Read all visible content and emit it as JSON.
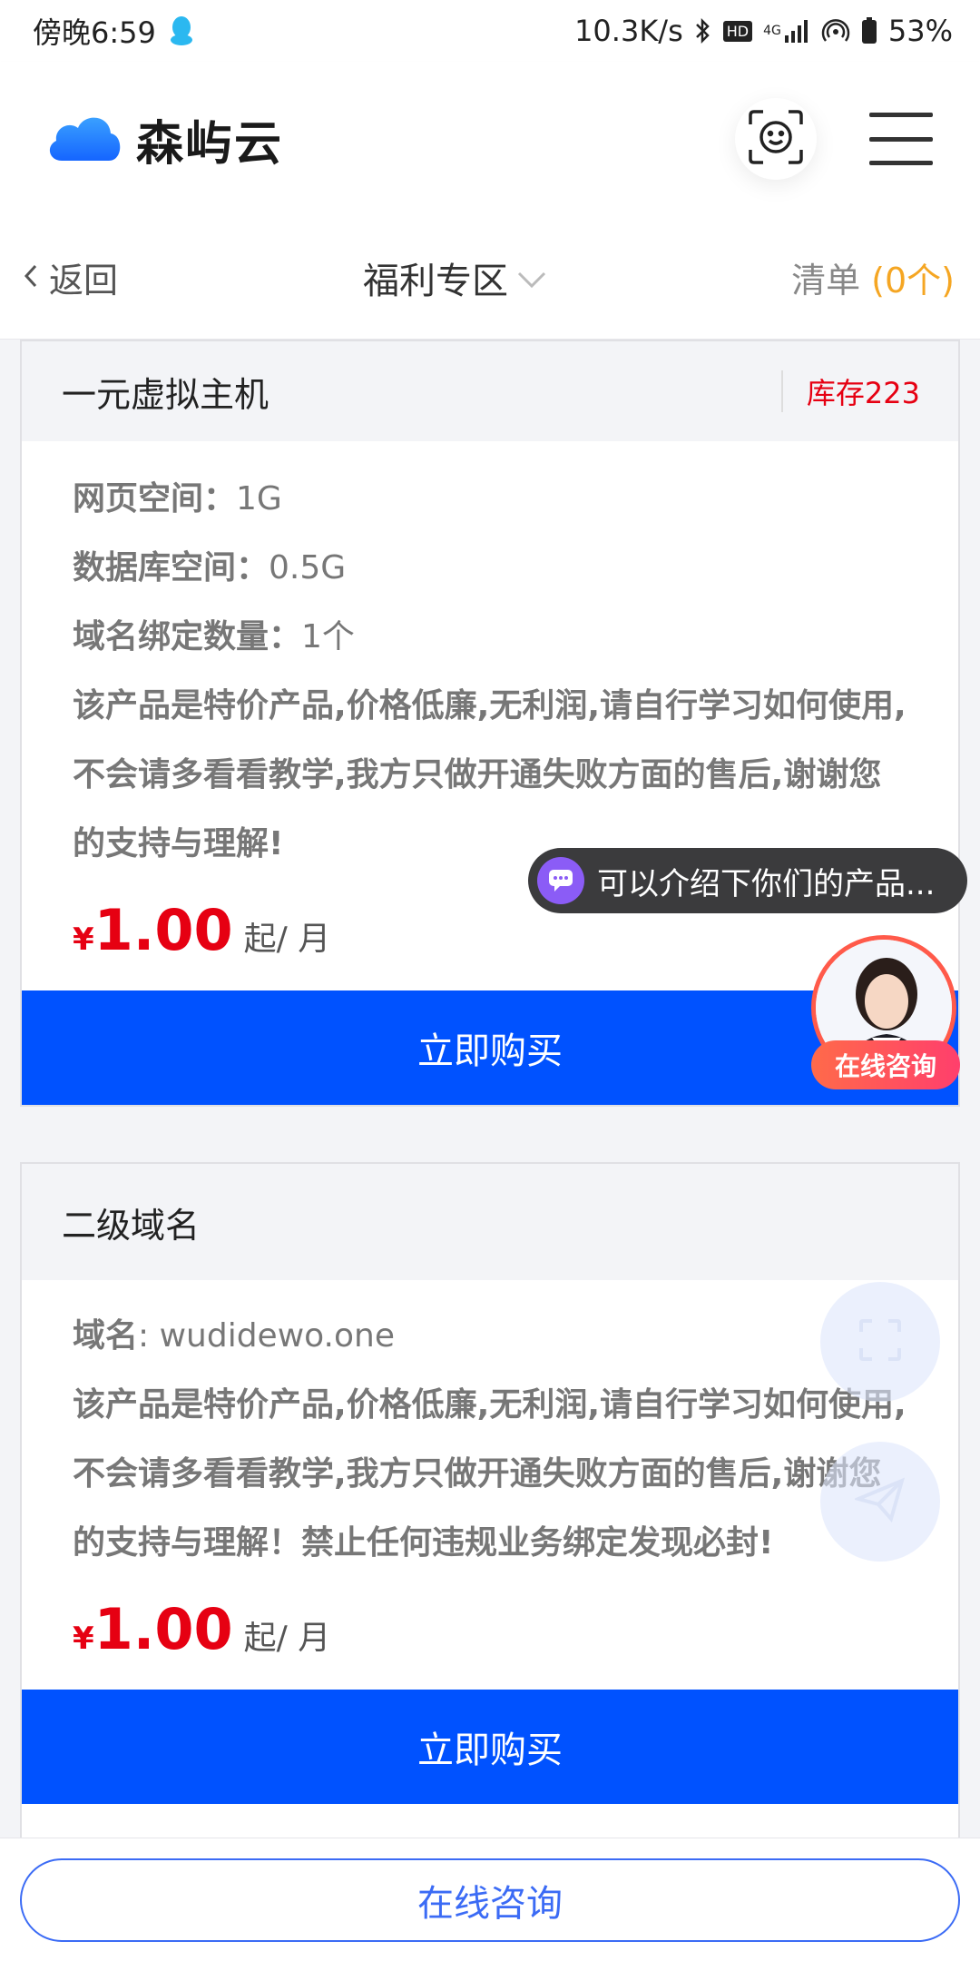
{
  "status_bar": {
    "time": "傍晚6:59",
    "net_speed": "10.3K/s",
    "hd": "HD",
    "network": "4G",
    "battery": "53%"
  },
  "header": {
    "brand": "森屿云"
  },
  "subnav": {
    "back_label": "返回",
    "title": "福利专区",
    "cart_label": "清单",
    "cart_count": "(0个)"
  },
  "products": [
    {
      "name": "一元虚拟主机",
      "stock": "库存223",
      "specs": [
        {
          "label": "网页空间：",
          "value": "1G"
        },
        {
          "label": "数据库空间：",
          "value": "0.5G"
        },
        {
          "label": "域名绑定数量：",
          "value": "1个"
        }
      ],
      "description": "该产品是特价产品,价格低廉,无利润,请自行学习如何使用,不会请多看看教学,我方只做开通失败方面的售后,谢谢您的支持与理解!",
      "currency": "¥",
      "price": "1.00",
      "unit": "起/ 月",
      "buy_label": "立即购买"
    },
    {
      "name": "二级域名",
      "specs": [
        {
          "label": "域名",
          "value": ": wudidewo.one"
        }
      ],
      "description": "该产品是特价产品,价格低廉,无利润,请自行学习如何使用,不会请多看看教学,我方只做开通失败方面的售后,谢谢您的支持与理解！禁止任何违规业务绑定发现必封!",
      "currency": "¥",
      "price": "1.00",
      "unit": "起/ 月",
      "buy_label": "立即购买"
    }
  ],
  "chat": {
    "bubble_text": "可以介绍下你们的产品...",
    "agent_label": "在线咨询"
  },
  "bottom": {
    "consult_label": "在线咨询"
  },
  "colors": {
    "primary": "#0052ff",
    "price": "#e60012",
    "cart_count": "#f5a623"
  }
}
